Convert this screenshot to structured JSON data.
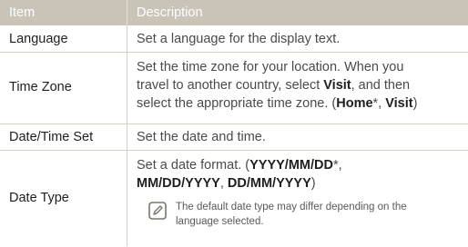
{
  "header": {
    "item": "Item",
    "description": "Description"
  },
  "rows": [
    {
      "label": "Language",
      "desc": "Set a language for the display text."
    },
    {
      "label": "Time Zone",
      "desc_l1": "Set the time zone for your location. When you",
      "desc_l2a": "travel to another country, select ",
      "desc_l2b": "Visit",
      "desc_l2c": ", and then",
      "desc_l3a": "select the appropriate time zone. (",
      "desc_l3b": "Home",
      "desc_l3c": "*, ",
      "desc_l3d": "Visit",
      "desc_l3e": ")"
    },
    {
      "label": "Date/Time Set",
      "desc": "Set the date and time."
    },
    {
      "label": "Date Type",
      "desc_l1a": "Set a date format. (",
      "desc_l1b": "YYYY/MM/DD",
      "desc_l1c": "*,",
      "desc_l2a": "MM/DD/YYYY",
      "desc_l2b": ", ",
      "desc_l2c": "DD/MM/YYYY",
      "desc_l2d": ")",
      "note_l1": "The default date type may differ depending on the",
      "note_l2": "language selected."
    }
  ],
  "icons": {
    "note": "note-pencil-icon"
  },
  "colors": {
    "header_bg": "#c9c3b8",
    "border": "#d6d0c5"
  }
}
